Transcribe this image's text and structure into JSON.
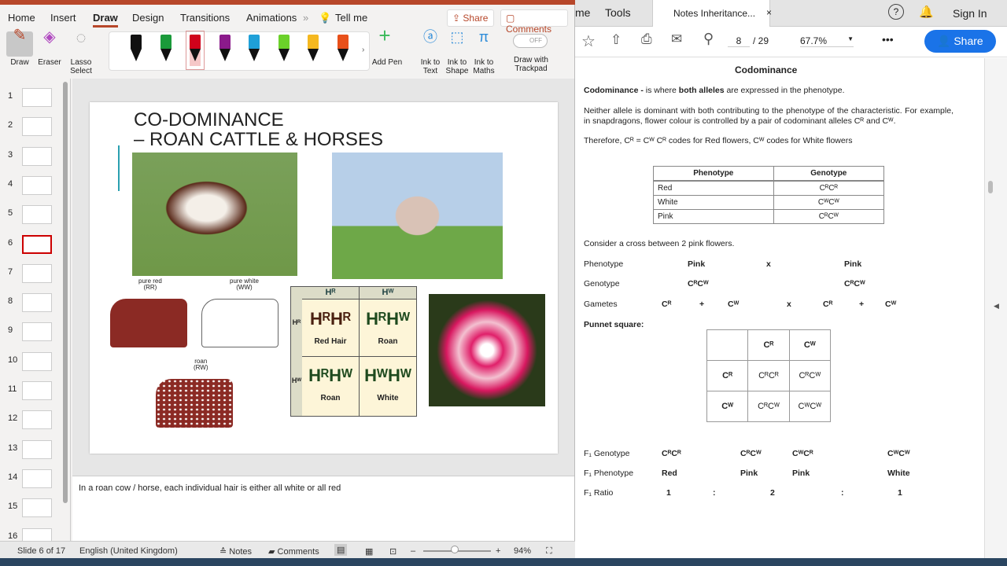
{
  "ppt": {
    "tabs": [
      "Home",
      "Insert",
      "Draw",
      "Design",
      "Transitions",
      "Animations"
    ],
    "active_tab": "Draw",
    "tell_me": "Tell me",
    "share": "Share",
    "comments": "Comments",
    "tools": {
      "draw": "Draw",
      "eraser": "Eraser",
      "lasso": "Lasso Select",
      "add_pen": "Add Pen",
      "ink_text": "Ink to Text",
      "ink_shape": "Ink to Shape",
      "ink_maths": "Ink to Maths",
      "trackpad": "Draw with Trackpad",
      "toggle": "OFF"
    },
    "pens": [
      "#111111",
      "#1a9a3a",
      "#d0021b",
      "#8b1a8b",
      "#1fa0d8",
      "#6bd12a",
      "#f5b820",
      "#e8501a"
    ],
    "thumbnails": [
      "1",
      "2",
      "3",
      "4",
      "5",
      "6",
      "7",
      "8",
      "9",
      "10",
      "11",
      "12",
      "13",
      "14",
      "15",
      "16"
    ],
    "selected_slide": "6",
    "slide": {
      "title_line1": "CO-DOMINANCE",
      "title_line2": "– ROAN CATTLE & HORSES",
      "pure_red": "pure red",
      "pure_red_g": "(RR)",
      "pure_white": "pure white",
      "pure_white_g": "(WW)",
      "roan": "roan",
      "roan_g": "(RW)",
      "punnett": {
        "col": [
          "Hᴿ",
          "Hᵂ"
        ],
        "row": [
          "Hᴿ",
          "Hᵂ"
        ],
        "cells": [
          [
            "HᴿHᴿ",
            "Red Hair"
          ],
          [
            "HᴿHᵂ",
            "Roan"
          ],
          [
            "HᴿHᵂ",
            "Roan"
          ],
          [
            "HᵂHᵂ",
            "White"
          ]
        ]
      }
    },
    "notes": "In a roan cow / horse, each individual hair is either all white or all red",
    "status": {
      "slide": "Slide 6 of 17",
      "lang": "English (United Kingdom)",
      "notes": "Notes",
      "comments": "Comments",
      "zoom": "94%"
    }
  },
  "pdf": {
    "tabs": {
      "home": "me",
      "tools": "Tools",
      "doc": "Notes Inheritance...",
      "signin": "Sign In"
    },
    "page": "8",
    "pages": "/ 29",
    "zoom": "67.7%",
    "share": "Share",
    "heading": "Codominance",
    "p1a": "Codominance -",
    "p1b": " is where ",
    "p1c": "both alleles",
    "p1d": " are expressed in the phenotype.",
    "p2": "Neither allele is dominant with both contributing to the phenotype of the characteristic. For example, in snapdragons, flower colour is controlled by a pair of codominant alleles Cᴿ and Cᵂ.",
    "p3": "Therefore, Cᴿ = Cᵂ    Cᴿ codes for Red flowers, Cᵂ codes for White flowers",
    "table": {
      "headers": [
        "Phenotype",
        "Genotype"
      ],
      "rows": [
        [
          "Red",
          "CᴿCᴿ"
        ],
        [
          "White",
          "CᵂCᵂ"
        ],
        [
          "Pink",
          "CᴿCᵂ"
        ]
      ]
    },
    "cross": "Consider a cross between 2 pink flowers.",
    "phenotype": [
      "Phenotype",
      "Pink",
      "x",
      "Pink"
    ],
    "genotype": [
      "Genotype",
      "CᴿCᵂ",
      "CᴿCᵂ"
    ],
    "gametes": [
      "Gametes",
      "Cᴿ",
      "+",
      "Cᵂ",
      "x",
      "Cᴿ",
      "+",
      "Cᵂ"
    ],
    "punnet_label": "Punnet square:",
    "punnet": [
      [
        "",
        "Cᴿ",
        "Cᵂ"
      ],
      [
        "Cᴿ",
        "CᴿCᴿ",
        "CᴿCᵂ"
      ],
      [
        "Cᵂ",
        "CᴿCᵂ",
        "CᵂCᵂ"
      ]
    ],
    "f1_genotype": [
      "F₁ Genotype",
      "CᴿCᴿ",
      "CᴿCᵂ",
      "CᵂCᴿ",
      "CᵂCᵂ"
    ],
    "f1_phenotype": [
      "F₁ Phenotype",
      "Red",
      "Pink",
      "Pink",
      "White"
    ],
    "f1_ratio": [
      "F₁ Ratio",
      "1",
      ":",
      "2",
      ":",
      "1"
    ]
  }
}
